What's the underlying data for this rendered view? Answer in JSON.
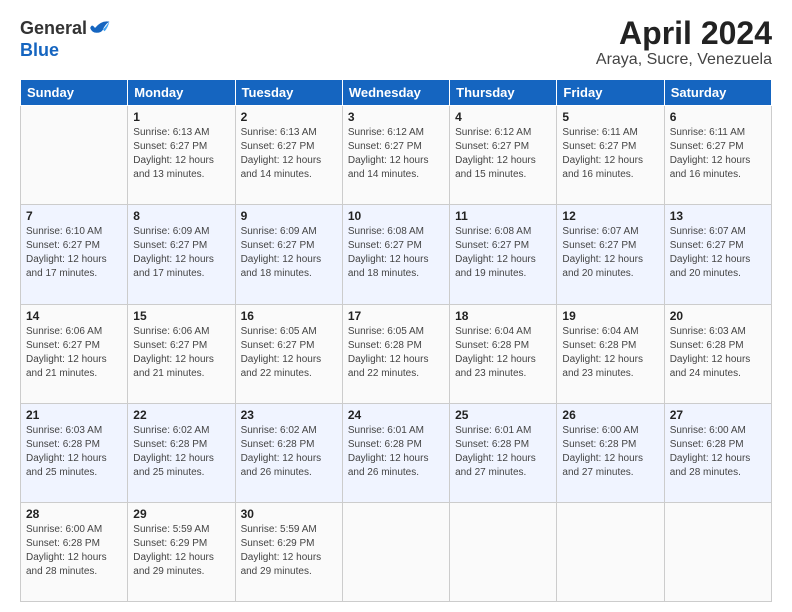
{
  "header": {
    "logo_general": "General",
    "logo_blue": "Blue",
    "month": "April 2024",
    "location": "Araya, Sucre, Venezuela"
  },
  "weekdays": [
    "Sunday",
    "Monday",
    "Tuesday",
    "Wednesday",
    "Thursday",
    "Friday",
    "Saturday"
  ],
  "weeks": [
    [
      {
        "day": "",
        "sunrise": "",
        "sunset": "",
        "daylight": ""
      },
      {
        "day": "1",
        "sunrise": "Sunrise: 6:13 AM",
        "sunset": "Sunset: 6:27 PM",
        "daylight": "Daylight: 12 hours and 13 minutes."
      },
      {
        "day": "2",
        "sunrise": "Sunrise: 6:13 AM",
        "sunset": "Sunset: 6:27 PM",
        "daylight": "Daylight: 12 hours and 14 minutes."
      },
      {
        "day": "3",
        "sunrise": "Sunrise: 6:12 AM",
        "sunset": "Sunset: 6:27 PM",
        "daylight": "Daylight: 12 hours and 14 minutes."
      },
      {
        "day": "4",
        "sunrise": "Sunrise: 6:12 AM",
        "sunset": "Sunset: 6:27 PM",
        "daylight": "Daylight: 12 hours and 15 minutes."
      },
      {
        "day": "5",
        "sunrise": "Sunrise: 6:11 AM",
        "sunset": "Sunset: 6:27 PM",
        "daylight": "Daylight: 12 hours and 16 minutes."
      },
      {
        "day": "6",
        "sunrise": "Sunrise: 6:11 AM",
        "sunset": "Sunset: 6:27 PM",
        "daylight": "Daylight: 12 hours and 16 minutes."
      }
    ],
    [
      {
        "day": "7",
        "sunrise": "Sunrise: 6:10 AM",
        "sunset": "Sunset: 6:27 PM",
        "daylight": "Daylight: 12 hours and 17 minutes."
      },
      {
        "day": "8",
        "sunrise": "Sunrise: 6:09 AM",
        "sunset": "Sunset: 6:27 PM",
        "daylight": "Daylight: 12 hours and 17 minutes."
      },
      {
        "day": "9",
        "sunrise": "Sunrise: 6:09 AM",
        "sunset": "Sunset: 6:27 PM",
        "daylight": "Daylight: 12 hours and 18 minutes."
      },
      {
        "day": "10",
        "sunrise": "Sunrise: 6:08 AM",
        "sunset": "Sunset: 6:27 PM",
        "daylight": "Daylight: 12 hours and 18 minutes."
      },
      {
        "day": "11",
        "sunrise": "Sunrise: 6:08 AM",
        "sunset": "Sunset: 6:27 PM",
        "daylight": "Daylight: 12 hours and 19 minutes."
      },
      {
        "day": "12",
        "sunrise": "Sunrise: 6:07 AM",
        "sunset": "Sunset: 6:27 PM",
        "daylight": "Daylight: 12 hours and 20 minutes."
      },
      {
        "day": "13",
        "sunrise": "Sunrise: 6:07 AM",
        "sunset": "Sunset: 6:27 PM",
        "daylight": "Daylight: 12 hours and 20 minutes."
      }
    ],
    [
      {
        "day": "14",
        "sunrise": "Sunrise: 6:06 AM",
        "sunset": "Sunset: 6:27 PM",
        "daylight": "Daylight: 12 hours and 21 minutes."
      },
      {
        "day": "15",
        "sunrise": "Sunrise: 6:06 AM",
        "sunset": "Sunset: 6:27 PM",
        "daylight": "Daylight: 12 hours and 21 minutes."
      },
      {
        "day": "16",
        "sunrise": "Sunrise: 6:05 AM",
        "sunset": "Sunset: 6:27 PM",
        "daylight": "Daylight: 12 hours and 22 minutes."
      },
      {
        "day": "17",
        "sunrise": "Sunrise: 6:05 AM",
        "sunset": "Sunset: 6:28 PM",
        "daylight": "Daylight: 12 hours and 22 minutes."
      },
      {
        "day": "18",
        "sunrise": "Sunrise: 6:04 AM",
        "sunset": "Sunset: 6:28 PM",
        "daylight": "Daylight: 12 hours and 23 minutes."
      },
      {
        "day": "19",
        "sunrise": "Sunrise: 6:04 AM",
        "sunset": "Sunset: 6:28 PM",
        "daylight": "Daylight: 12 hours and 23 minutes."
      },
      {
        "day": "20",
        "sunrise": "Sunrise: 6:03 AM",
        "sunset": "Sunset: 6:28 PM",
        "daylight": "Daylight: 12 hours and 24 minutes."
      }
    ],
    [
      {
        "day": "21",
        "sunrise": "Sunrise: 6:03 AM",
        "sunset": "Sunset: 6:28 PM",
        "daylight": "Daylight: 12 hours and 25 minutes."
      },
      {
        "day": "22",
        "sunrise": "Sunrise: 6:02 AM",
        "sunset": "Sunset: 6:28 PM",
        "daylight": "Daylight: 12 hours and 25 minutes."
      },
      {
        "day": "23",
        "sunrise": "Sunrise: 6:02 AM",
        "sunset": "Sunset: 6:28 PM",
        "daylight": "Daylight: 12 hours and 26 minutes."
      },
      {
        "day": "24",
        "sunrise": "Sunrise: 6:01 AM",
        "sunset": "Sunset: 6:28 PM",
        "daylight": "Daylight: 12 hours and 26 minutes."
      },
      {
        "day": "25",
        "sunrise": "Sunrise: 6:01 AM",
        "sunset": "Sunset: 6:28 PM",
        "daylight": "Daylight: 12 hours and 27 minutes."
      },
      {
        "day": "26",
        "sunrise": "Sunrise: 6:00 AM",
        "sunset": "Sunset: 6:28 PM",
        "daylight": "Daylight: 12 hours and 27 minutes."
      },
      {
        "day": "27",
        "sunrise": "Sunrise: 6:00 AM",
        "sunset": "Sunset: 6:28 PM",
        "daylight": "Daylight: 12 hours and 28 minutes."
      }
    ],
    [
      {
        "day": "28",
        "sunrise": "Sunrise: 6:00 AM",
        "sunset": "Sunset: 6:28 PM",
        "daylight": "Daylight: 12 hours and 28 minutes."
      },
      {
        "day": "29",
        "sunrise": "Sunrise: 5:59 AM",
        "sunset": "Sunset: 6:29 PM",
        "daylight": "Daylight: 12 hours and 29 minutes."
      },
      {
        "day": "30",
        "sunrise": "Sunrise: 5:59 AM",
        "sunset": "Sunset: 6:29 PM",
        "daylight": "Daylight: 12 hours and 29 minutes."
      },
      {
        "day": "",
        "sunrise": "",
        "sunset": "",
        "daylight": ""
      },
      {
        "day": "",
        "sunrise": "",
        "sunset": "",
        "daylight": ""
      },
      {
        "day": "",
        "sunrise": "",
        "sunset": "",
        "daylight": ""
      },
      {
        "day": "",
        "sunrise": "",
        "sunset": "",
        "daylight": ""
      }
    ]
  ]
}
